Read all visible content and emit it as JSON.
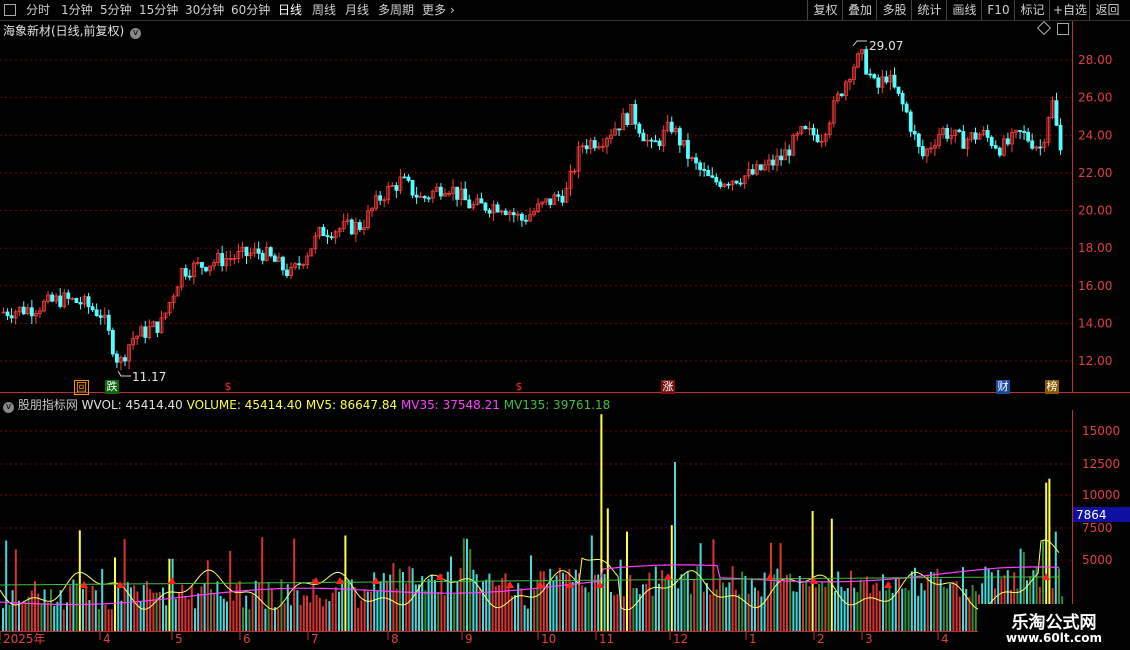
{
  "toolbar": {
    "periods": [
      "分时",
      "1分钟",
      "5分钟",
      "15分钟",
      "30分钟",
      "60分钟",
      "日线",
      "周线",
      "月线",
      "多周期",
      "更多"
    ],
    "active_period": "日线",
    "right_buttons": [
      "复权",
      "叠加",
      "多股",
      "统计",
      "画线",
      "F10",
      "标记",
      "+自选",
      "返回"
    ]
  },
  "stock": {
    "title": "海象新材(日线,前复权)",
    "high_label": "29.07",
    "low_label": "11.17"
  },
  "price_axis": [
    "28.00",
    "26.00",
    "24.00",
    "22.00",
    "20.00",
    "18.00",
    "16.00",
    "14.00",
    "12.00"
  ],
  "markers": [
    {
      "text": "回",
      "color": "#ff9a00",
      "bg": "#3a2a00"
    },
    {
      "text": "跌",
      "color": "#ffffff",
      "bg": "#0a6a0a"
    },
    {
      "text": "$",
      "color": "#ff3030",
      "bg": "transparent"
    },
    {
      "text": "$",
      "color": "#ff3030",
      "bg": "transparent"
    },
    {
      "text": "涨",
      "color": "#ffffff",
      "bg": "#7a1010"
    },
    {
      "text": "财",
      "color": "#ffffff",
      "bg": "#1a4a9a"
    },
    {
      "text": "榜",
      "color": "#ffffff",
      "bg": "#8a5a00"
    }
  ],
  "indicator": {
    "name": "股朋指标网",
    "wvol": "WVOL: 45414.40",
    "volume": "VOLUME: 45414.40",
    "mv5": "MV5: 86647.84",
    "mv35": "MV35: 37548.21",
    "mv135": "MV135: 39761.18",
    "colors": {
      "name": "#c8c8c8",
      "wvol": "#e0e0e0",
      "volume": "#ffff40",
      "mv5": "#ffff40",
      "mv35": "#ff40ff",
      "mv135": "#40c040"
    }
  },
  "vol_axis": [
    "15000",
    "12500",
    "10000",
    "7500",
    "5000"
  ],
  "vol_current": "7864",
  "date_axis": [
    "2025年",
    "4",
    "5",
    "6",
    "7",
    "8",
    "9",
    "10",
    "11",
    "12",
    "1",
    "2",
    "3",
    "4"
  ],
  "watermark": {
    "line1": "乐淘公式网",
    "line2": "www.60lt.com"
  },
  "colors": {
    "up": "#ff3c3c",
    "down": "#54ffff",
    "grid": "#7a0000",
    "axis": "#c03030",
    "bg": "#000000"
  }
}
